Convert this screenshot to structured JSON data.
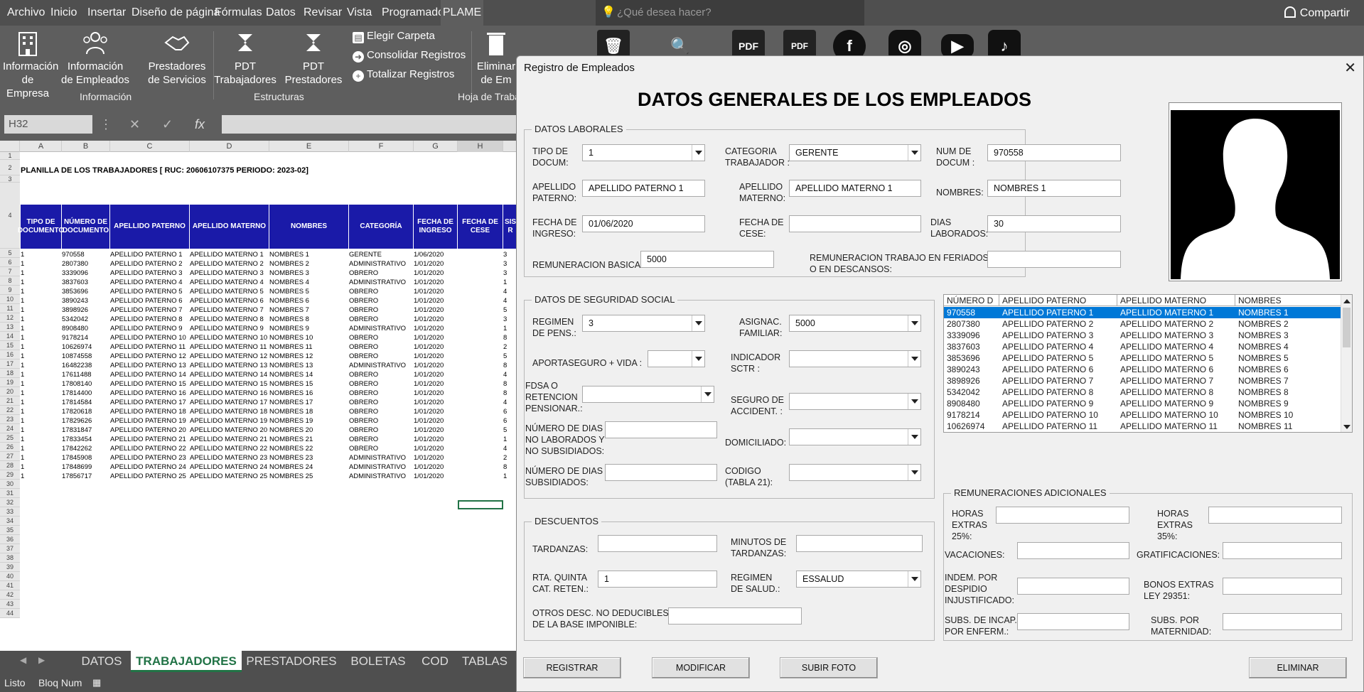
{
  "ribbon_tabs": [
    "Archivo",
    "Inicio",
    "Insertar",
    "Diseño de página",
    "Fórmulas",
    "Datos",
    "Revisar",
    "Vista",
    "Programador",
    "PLAME"
  ],
  "tell_me_placeholder": "¿Qué desea hacer?",
  "share_label": "Compartir",
  "ribbon": {
    "buttons": [
      {
        "label1": "Información",
        "label2": "de Empresa"
      },
      {
        "label1": "Información",
        "label2": "de Empleados"
      },
      {
        "label1": "Prestadores",
        "label2": "de Servicios"
      },
      {
        "label1": "PDT",
        "label2": "Trabajadores"
      },
      {
        "label1": "PDT",
        "label2": "Prestadores"
      },
      {
        "label1": "Eliminar",
        "label2": "de Em"
      }
    ],
    "small": [
      "Elegir Carpeta",
      "Consolidar Registros",
      "Totalizar Registros"
    ],
    "groups": [
      "Información",
      "Estructuras",
      "Hoja de Traba"
    ]
  },
  "name_box": "H32",
  "sheet": {
    "columns": [
      "A",
      "B",
      "C",
      "D",
      "E",
      "F",
      "G",
      "H"
    ],
    "title": "PLANILLA DE LOS TRABAJADORES [ RUC: 20606107375  PERIODO: 2023-02]",
    "headers": [
      "TIPO DE DOCUMENTO",
      "NÚMERO DE DOCUMENTO",
      "APELLIDO PATERNO",
      "APELLIDO MATERNO",
      "NOMBRES",
      "CATEGORÍA",
      "FECHA DE INGRESO",
      "FECHA DE CESE",
      "SIS R"
    ],
    "rows": [
      [
        "1",
        "970558",
        "APELLIDO PATERNO 1",
        "APELLIDO MATERNO 1",
        "NOMBRES 1",
        "GERENTE",
        "1/06/2020",
        "",
        "3"
      ],
      [
        "1",
        "2807380",
        "APELLIDO PATERNO 2",
        "APELLIDO MATERNO 2",
        "NOMBRES 2",
        "ADMINISTRATIVO",
        "1/01/2020",
        "",
        "3"
      ],
      [
        "1",
        "3339096",
        "APELLIDO PATERNO 3",
        "APELLIDO MATERNO 3",
        "NOMBRES 3",
        "OBRERO",
        "1/01/2020",
        "",
        "3"
      ],
      [
        "1",
        "3837603",
        "APELLIDO PATERNO 4",
        "APELLIDO MATERNO 4",
        "NOMBRES 4",
        "ADMINISTRATIVO",
        "1/01/2020",
        "",
        "1"
      ],
      [
        "1",
        "3853696",
        "APELLIDO PATERNO 5",
        "APELLIDO MATERNO 5",
        "NOMBRES 5",
        "OBRERO",
        "1/01/2020",
        "",
        "4"
      ],
      [
        "1",
        "3890243",
        "APELLIDO PATERNO 6",
        "APELLIDO MATERNO 6",
        "NOMBRES 6",
        "OBRERO",
        "1/01/2020",
        "",
        "4"
      ],
      [
        "1",
        "3898926",
        "APELLIDO PATERNO 7",
        "APELLIDO MATERNO 7",
        "NOMBRES 7",
        "OBRERO",
        "1/01/2020",
        "",
        "5"
      ],
      [
        "1",
        "5342042",
        "APELLIDO PATERNO 8",
        "APELLIDO MATERNO 8",
        "NOMBRES 8",
        "OBRERO",
        "1/01/2020",
        "",
        "3"
      ],
      [
        "1",
        "8908480",
        "APELLIDO PATERNO 9",
        "APELLIDO MATERNO 9",
        "NOMBRES 9",
        "ADMINISTRATIVO",
        "1/01/2020",
        "",
        "1"
      ],
      [
        "1",
        "9178214",
        "APELLIDO PATERNO 10",
        "APELLIDO MATERNO 10",
        "NOMBRES 10",
        "OBRERO",
        "1/01/2020",
        "",
        "8"
      ],
      [
        "1",
        "10626974",
        "APELLIDO PATERNO 11",
        "APELLIDO MATERNO 11",
        "NOMBRES 11",
        "OBRERO",
        "1/01/2020",
        "",
        "2"
      ],
      [
        "1",
        "10874558",
        "APELLIDO PATERNO 12",
        "APELLIDO MATERNO 12",
        "NOMBRES 12",
        "OBRERO",
        "1/01/2020",
        "",
        "5"
      ],
      [
        "1",
        "16482238",
        "APELLIDO PATERNO 13",
        "APELLIDO MATERNO 13",
        "NOMBRES 13",
        "ADMINISTRATIVO",
        "1/01/2020",
        "",
        "8"
      ],
      [
        "1",
        "17611488",
        "APELLIDO PATERNO 14",
        "APELLIDO MATERNO 14",
        "NOMBRES 14",
        "OBRERO",
        "1/01/2020",
        "",
        "4"
      ],
      [
        "1",
        "17808140",
        "APELLIDO PATERNO 15",
        "APELLIDO MATERNO 15",
        "NOMBRES 15",
        "OBRERO",
        "1/01/2020",
        "",
        "8"
      ],
      [
        "1",
        "17814400",
        "APELLIDO PATERNO 16",
        "APELLIDO MATERNO 16",
        "NOMBRES 16",
        "OBRERO",
        "1/01/2020",
        "",
        "8"
      ],
      [
        "1",
        "17814584",
        "APELLIDO PATERNO 17",
        "APELLIDO MATERNO 17",
        "NOMBRES 17",
        "OBRERO",
        "1/01/2020",
        "",
        "4"
      ],
      [
        "1",
        "17820618",
        "APELLIDO PATERNO 18",
        "APELLIDO MATERNO 18",
        "NOMBRES 18",
        "OBRERO",
        "1/01/2020",
        "",
        "6"
      ],
      [
        "1",
        "17829626",
        "APELLIDO PATERNO 19",
        "APELLIDO MATERNO 19",
        "NOMBRES 19",
        "OBRERO",
        "1/01/2020",
        "",
        "6"
      ],
      [
        "1",
        "17831847",
        "APELLIDO PATERNO 20",
        "APELLIDO MATERNO 20",
        "NOMBRES 20",
        "OBRERO",
        "1/01/2020",
        "",
        "5"
      ],
      [
        "1",
        "17833454",
        "APELLIDO PATERNO 21",
        "APELLIDO MATERNO 21",
        "NOMBRES 21",
        "OBRERO",
        "1/01/2020",
        "",
        "1"
      ],
      [
        "1",
        "17842262",
        "APELLIDO PATERNO 22",
        "APELLIDO MATERNO 22",
        "NOMBRES 22",
        "OBRERO",
        "1/01/2020",
        "",
        "4"
      ],
      [
        "1",
        "17845908",
        "APELLIDO PATERNO 23",
        "APELLIDO MATERNO 23",
        "NOMBRES 23",
        "ADMINISTRATIVO",
        "1/01/2020",
        "",
        "2"
      ],
      [
        "1",
        "17848699",
        "APELLIDO PATERNO 24",
        "APELLIDO MATERNO 24",
        "NOMBRES 24",
        "ADMINISTRATIVO",
        "1/01/2020",
        "",
        "8"
      ],
      [
        "1",
        "17856717",
        "APELLIDO PATERNO 25",
        "APELLIDO MATERNO 25",
        "NOMBRES 25",
        "ADMINISTRATIVO",
        "1/01/2020",
        "",
        "1"
      ]
    ]
  },
  "sheet_tabs": [
    "DATOS",
    "TRABAJADORES",
    "PRESTADORES",
    "BOLETAS",
    "COD",
    "TABLAS"
  ],
  "status": [
    "Listo",
    "Bloq Num"
  ],
  "dialog": {
    "title": "Registro de Empleados",
    "heading": "DATOS GENERALES DE LOS EMPLEADOS",
    "laborales": {
      "frame": "DATOS LABORALES",
      "tipo_docum_label": "TIPO DE\nDOCUM:",
      "tipo_docum": "1",
      "categoria_label": "CATEGORIA\nTRABAJADOR :",
      "categoria": "GERENTE",
      "num_docum_label": "NUM DE\nDOCUM :",
      "num_docum": "970558",
      "ap_paterno_label": "APELLIDO\nPATERNO:",
      "ap_paterno": "APELLIDO PATERNO 1",
      "ap_materno_label": "APELLIDO\nMATERNO:",
      "ap_materno": "APELLIDO MATERNO 1",
      "nombres_label": "NOMBRES:",
      "nombres": "NOMBRES 1",
      "fecha_ingreso_label": "FECHA DE\nINGRESO:",
      "fecha_ingreso": "01/06/2020",
      "fecha_cese_label": "FECHA DE\nCESE:",
      "fecha_cese": "",
      "dias_label": "DIAS\nLABORADOS:",
      "dias": "30",
      "rem_basica_label": "REMUNERACION BASICA:",
      "rem_basica": "5000",
      "rem_feriados_label": "REMUNERACION TRABAJO EN FERIADOS\nO EN DESCANSOS:",
      "rem_feriados": ""
    },
    "seguridad": {
      "frame": "DATOS DE SEGURIDAD SOCIAL",
      "regimen_pens_label": "REGIMEN\nDE PENS.:",
      "regimen_pens": "3",
      "asignac_label": "ASIGNAC.\nFAMILIAR:",
      "asignac": "5000",
      "aporte_label": "APORTASEGURO + VIDA :",
      "aporte": "",
      "sctr_label": "INDICADOR\nSCTR :",
      "sctr": "",
      "fdsa_label": "FDSA O\nRETENCION\nPENSIONAR.:",
      "fdsa": "",
      "seguro_acc_label": "SEGURO DE\nACCIDENT. :",
      "seguro_acc": "",
      "dias_no_lab_label": "NÚMERO DE DIAS\nNO LABORADOS Y\nNO SUBSIDIADOS:",
      "dias_no_lab": "",
      "domiciliado_label": "DOMICILIADO:",
      "domiciliado": "",
      "dias_subs_label": "NÚMERO DE DIAS\nSUBSIDIADOS:",
      "dias_subs": "",
      "codigo_label": "CODIGO\n(TABLA 21):",
      "codigo": ""
    },
    "descuentos": {
      "frame": "DESCUENTOS",
      "tardanzas_label": "TARDANZAS:",
      "tardanzas": "",
      "minutos_label": "MINUTOS DE\nTARDANZAS:",
      "minutos": "",
      "rta_label": "RTA. QUINTA\nCAT. RETEN.:",
      "rta": "1",
      "regimen_salud_label": "REGIMEN\nDE SALUD.:",
      "regimen_salud": "ESSALUD",
      "otros_label": "OTROS DESC. NO DEDUCIBLES\nDE LA BASE IMPONIBLE:",
      "otros": ""
    },
    "remuneraciones": {
      "frame": "REMUNERACIONES ADICIONALES",
      "horas25_label": "HORAS\nEXTRAS\n25%:",
      "horas25": "",
      "horas35_label": "HORAS\nEXTRAS\n35%:",
      "horas35": "",
      "vacaciones_label": "VACACIONES:",
      "vacaciones": "",
      "gratificaciones_label": "GRATIFICACIONES:",
      "gratificaciones": "",
      "indem_label": "INDEM. POR\nDESPIDIO\nINJUSTIFICADO:",
      "indem": "",
      "bonos_label": "BONOS EXTRAS\nLEY 29351:",
      "bonos": "",
      "subs_enferm_label": "SUBS. DE INCAP.\nPOR ENFERM.:",
      "subs_enferm": "",
      "subs_mat_label": "SUBS. POR\nMATERNIDAD:",
      "subs_mat": ""
    },
    "list": {
      "headers": [
        "NÚMERO D",
        "APELLIDO PATERNO",
        "APELLIDO MATERNO",
        "NOMBRES"
      ],
      "rows": [
        [
          "970558",
          "APELLIDO PATERNO 1",
          "APELLIDO MATERNO 1",
          "NOMBRES 1"
        ],
        [
          "2807380",
          "APELLIDO PATERNO 2",
          "APELLIDO MATERNO 2",
          "NOMBRES 2"
        ],
        [
          "3339096",
          "APELLIDO PATERNO 3",
          "APELLIDO MATERNO 3",
          "NOMBRES 3"
        ],
        [
          "3837603",
          "APELLIDO PATERNO 4",
          "APELLIDO MATERNO 4",
          "NOMBRES 4"
        ],
        [
          "3853696",
          "APELLIDO PATERNO 5",
          "APELLIDO MATERNO 5",
          "NOMBRES 5"
        ],
        [
          "3890243",
          "APELLIDO PATERNO 6",
          "APELLIDO MATERNO 6",
          "NOMBRES 6"
        ],
        [
          "3898926",
          "APELLIDO PATERNO 7",
          "APELLIDO MATERNO 7",
          "NOMBRES 7"
        ],
        [
          "5342042",
          "APELLIDO PATERNO 8",
          "APELLIDO MATERNO 8",
          "NOMBRES 8"
        ],
        [
          "8908480",
          "APELLIDO PATERNO 9",
          "APELLIDO MATERNO 9",
          "NOMBRES 9"
        ],
        [
          "9178214",
          "APELLIDO PATERNO 10",
          "APELLIDO MATERNO 10",
          "NOMBRES 10"
        ],
        [
          "10626974",
          "APELLIDO PATERNO 11",
          "APELLIDO MATERNO 11",
          "NOMBRES 11"
        ]
      ]
    },
    "buttons": {
      "registrar": "REGISTRAR",
      "modificar": "MODIFICAR",
      "subir_foto": "SUBIR FOTO",
      "eliminar": "ELIMINAR"
    }
  },
  "colors": {
    "header_blue": "#1a1aa8",
    "excel_green": "#217346",
    "ribbon_gray": "#5e5e5e",
    "selection_blue": "#0078d7"
  }
}
